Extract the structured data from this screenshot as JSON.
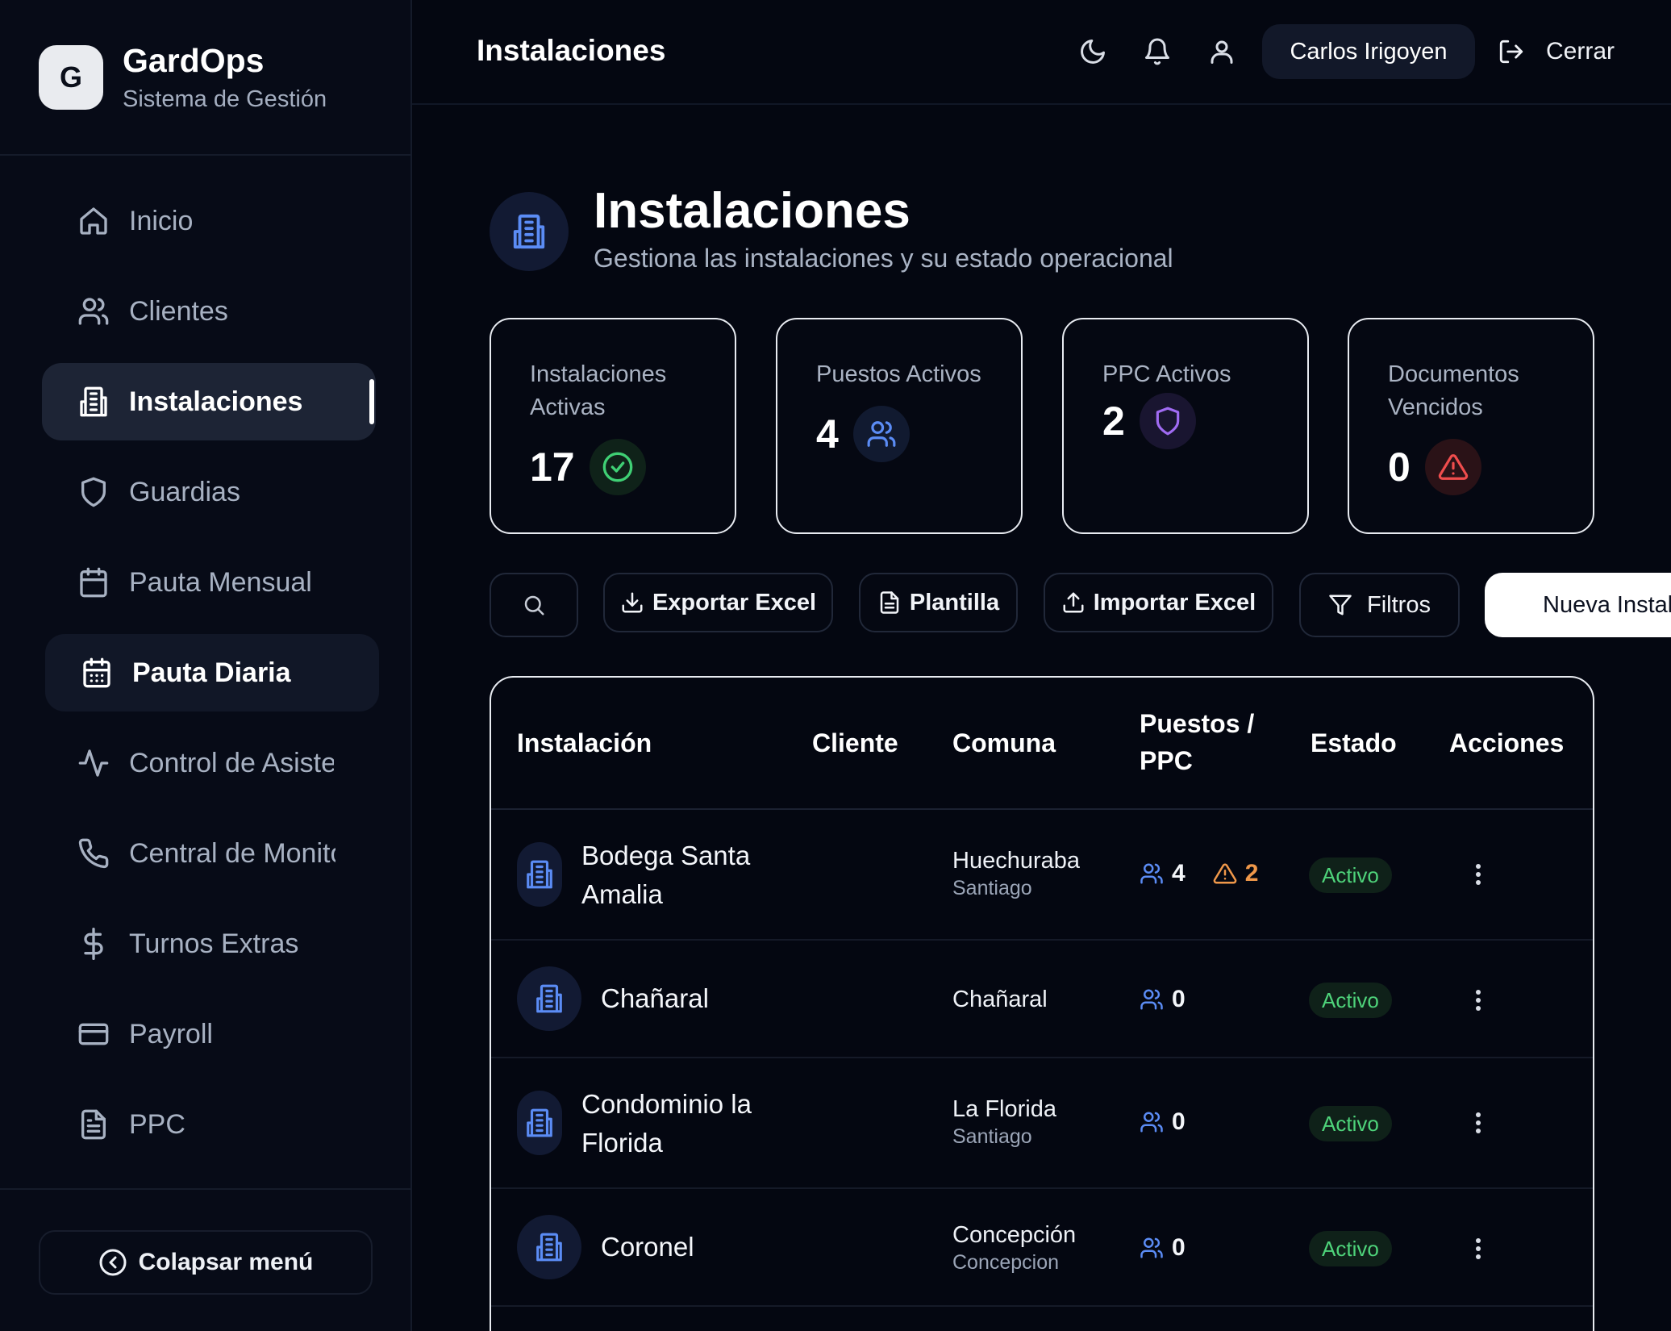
{
  "brand": {
    "logo_letter": "G",
    "name": "GardOps",
    "subtitle": "Sistema de Gestión"
  },
  "sidebar": {
    "items": [
      {
        "label": "Inicio",
        "icon": "home-icon"
      },
      {
        "label": "Clientes",
        "icon": "users-icon"
      },
      {
        "label": "Instalaciones",
        "icon": "building-icon",
        "active": true
      },
      {
        "label": "Guardias",
        "icon": "shield-icon"
      },
      {
        "label": "Pauta Mensual",
        "icon": "calendar-icon"
      },
      {
        "label": "Pauta Diaria",
        "icon": "calendar-days-icon",
        "highlighted": true
      },
      {
        "label": "Control de Asistencia",
        "icon": "activity-icon"
      },
      {
        "label": "Central de Monitoreo",
        "icon": "phone-icon"
      },
      {
        "label": "Turnos Extras",
        "icon": "dollar-icon"
      },
      {
        "label": "Payroll",
        "icon": "credit-card-icon"
      },
      {
        "label": "PPC",
        "icon": "file-text-icon"
      }
    ],
    "collapse_label": "Colapsar menú"
  },
  "header": {
    "title": "Instalaciones",
    "user_name": "Carlos Irigoyen",
    "logout_label": "Cerrar"
  },
  "page": {
    "title": "Instalaciones",
    "subtitle": "Gestiona las instalaciones y su estado operacional"
  },
  "stats": [
    {
      "label": "Instalaciones Activas",
      "value": "17",
      "icon": "check-circle-icon",
      "color": "#3fcf74"
    },
    {
      "label": "Puestos Activos",
      "value": "4",
      "icon": "users-icon",
      "color": "#5b8cf5"
    },
    {
      "label": "PPC Activos",
      "value": "2",
      "icon": "shield-icon",
      "color": "#a06bf2"
    },
    {
      "label": "Documentos Vencidos",
      "value": "0",
      "icon": "alert-triangle-icon",
      "color": "#ef4d4d"
    }
  ],
  "toolbar": {
    "export_label": "Exportar Excel",
    "template_label": "Plantilla",
    "import_label": "Importar Excel",
    "filters_label": "Filtros",
    "new_label": "Nueva Instalación"
  },
  "table": {
    "columns": [
      "Instalación",
      "Cliente",
      "Comuna",
      "Puestos / PPC",
      "Estado",
      "Acciones"
    ],
    "rows": [
      {
        "name": "Bodega Santa Amalia",
        "cliente": "",
        "comuna": "Huechuraba",
        "ciudad": "Santiago",
        "puestos": "4",
        "ppc": "2",
        "estado": "Activo"
      },
      {
        "name": "Chañaral",
        "cliente": "",
        "comuna": "Chañaral",
        "ciudad": "",
        "puestos": "0",
        "ppc": "",
        "estado": "Activo"
      },
      {
        "name": "Condominio la Florida",
        "cliente": "",
        "comuna": "La Florida",
        "ciudad": "Santiago",
        "puestos": "0",
        "ppc": "",
        "estado": "Activo"
      },
      {
        "name": "Coronel",
        "cliente": "",
        "comuna": "Concepción",
        "ciudad": "Concepcion",
        "puestos": "0",
        "ppc": "",
        "estado": "Activo"
      }
    ]
  },
  "colors": {
    "background": "#040711",
    "accent_blue": "#5b8cf5",
    "status_green": "#4ed37a",
    "warning_orange": "#f0984a"
  }
}
